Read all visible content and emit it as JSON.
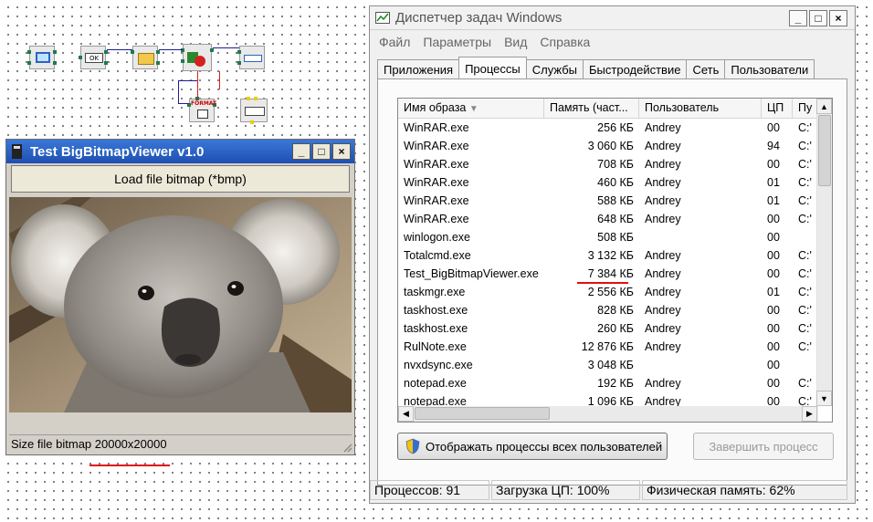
{
  "viewer": {
    "title": "Test BigBitmapViewer v1.0",
    "load_button": "Load file bitmap (*bmp)",
    "status": "Size file bitmap 20000x20000",
    "window_buttons": [
      "_",
      "□",
      "×"
    ]
  },
  "schematic": {
    "button_component_label": "OK",
    "format_component_label": "FORMAT"
  },
  "taskmanager": {
    "title": "Диспетчер задач Windows",
    "menu": [
      "Файл",
      "Параметры",
      "Вид",
      "Справка"
    ],
    "tabs": [
      "Приложения",
      "Процессы",
      "Службы",
      "Быстродействие",
      "Сеть",
      "Пользователи"
    ],
    "active_tab": "Процессы",
    "columns": [
      "Имя образа",
      "Память (част...",
      "Пользователь",
      "ЦП",
      "Пу"
    ],
    "rows": [
      {
        "name": "WinRAR.exe",
        "mem": "256 КБ",
        "user": "Andrey",
        "cpu": "00",
        "path": "C:'"
      },
      {
        "name": "WinRAR.exe",
        "mem": "3 060 КБ",
        "user": "Andrey",
        "cpu": "94",
        "path": "C:'"
      },
      {
        "name": "WinRAR.exe",
        "mem": "708 КБ",
        "user": "Andrey",
        "cpu": "00",
        "path": "C:'"
      },
      {
        "name": "WinRAR.exe",
        "mem": "460 КБ",
        "user": "Andrey",
        "cpu": "01",
        "path": "C:'"
      },
      {
        "name": "WinRAR.exe",
        "mem": "588 КБ",
        "user": "Andrey",
        "cpu": "01",
        "path": "C:'"
      },
      {
        "name": "WinRAR.exe",
        "mem": "648 КБ",
        "user": "Andrey",
        "cpu": "00",
        "path": "C:'"
      },
      {
        "name": "winlogon.exe",
        "mem": "508 КБ",
        "user": "",
        "cpu": "00",
        "path": ""
      },
      {
        "name": "Totalcmd.exe",
        "mem": "3 132 КБ",
        "user": "Andrey",
        "cpu": "00",
        "path": "C:'"
      },
      {
        "name": "Test_BigBitmapViewer.exe",
        "mem": "7 384 КБ",
        "user": "Andrey",
        "cpu": "00",
        "path": "C:'"
      },
      {
        "name": "taskmgr.exe",
        "mem": "2 556 КБ",
        "user": "Andrey",
        "cpu": "01",
        "path": "C:'"
      },
      {
        "name": "taskhost.exe",
        "mem": "828 КБ",
        "user": "Andrey",
        "cpu": "00",
        "path": "C:'"
      },
      {
        "name": "taskhost.exe",
        "mem": "260 КБ",
        "user": "Andrey",
        "cpu": "00",
        "path": "C:'"
      },
      {
        "name": "RulNote.exe",
        "mem": "12 876 КБ",
        "user": "Andrey",
        "cpu": "00",
        "path": "C:'"
      },
      {
        "name": "nvxdsync.exe",
        "mem": "3 048 КБ",
        "user": "",
        "cpu": "00",
        "path": ""
      },
      {
        "name": "notepad.exe",
        "mem": "192 КБ",
        "user": "Andrey",
        "cpu": "00",
        "path": "C:'"
      },
      {
        "name": "notepad.exe",
        "mem": "1 096 КБ",
        "user": "Andrey",
        "cpu": "00",
        "path": "C:'"
      }
    ],
    "show_all_button": "Отображать процессы всех пользователей",
    "end_process_button": "Завершить процесс",
    "status": {
      "processes": "Процессов: 91",
      "cpu": "Загрузка ЦП: 100%",
      "memory": "Физическая память: 62%"
    }
  },
  "colors": {
    "accent_red": "#e01010",
    "xp_title": "#2a63c6"
  }
}
